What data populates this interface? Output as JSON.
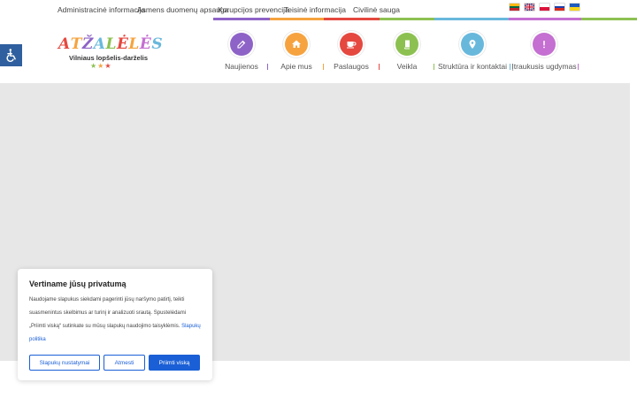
{
  "topnav": {
    "links": [
      "Administracinė informacija",
      "Asmens duomenų apsauga",
      "Korupcijos prevencija",
      "Teisinė informacija",
      "Civilinė sauga"
    ]
  },
  "languages": [
    "lt",
    "en",
    "pl",
    "ru",
    "ua"
  ],
  "accessibility": {
    "icon": "accessibility-icon"
  },
  "logo": {
    "title": "AtŽaLėLėS",
    "subtitle": "Vilniaus lopšelis-darželis",
    "stars": "★★★"
  },
  "mainnav": {
    "items": [
      {
        "label": "Naujienos",
        "icon": "edit-icon",
        "color": "#8e63c7"
      },
      {
        "label": "Apie mus",
        "icon": "home-icon",
        "color": "#f6a33f"
      },
      {
        "label": "Paslaugos",
        "icon": "cup-icon",
        "color": "#e5483f"
      },
      {
        "label": "Veikla",
        "icon": "book-icon",
        "color": "#8cc151"
      },
      {
        "label": "Struktūra ir kontaktai",
        "icon": "location-icon",
        "color": "#68b8dc"
      },
      {
        "label": "Įtraukusis ugdymas",
        "icon": "alert-icon",
        "color": "#c46fd1"
      }
    ]
  },
  "cookie": {
    "title": "Vertiname jūsų privatumą",
    "body": "Naudojame slapukus siekdami pagerinti jūsų naršymo patirtį, teikti suasmenintus skelbimus ar turinį ir analizuoti srautą. Spustelėdami „Priimti viską“ sutinkate su mūsų slapukų naudojimo taisyklėmis.",
    "link": "Slapukų politika",
    "buttons": {
      "settings": "Slapukų nustatymai",
      "reject": "Atmesti",
      "accept": "Priimti viską"
    }
  }
}
